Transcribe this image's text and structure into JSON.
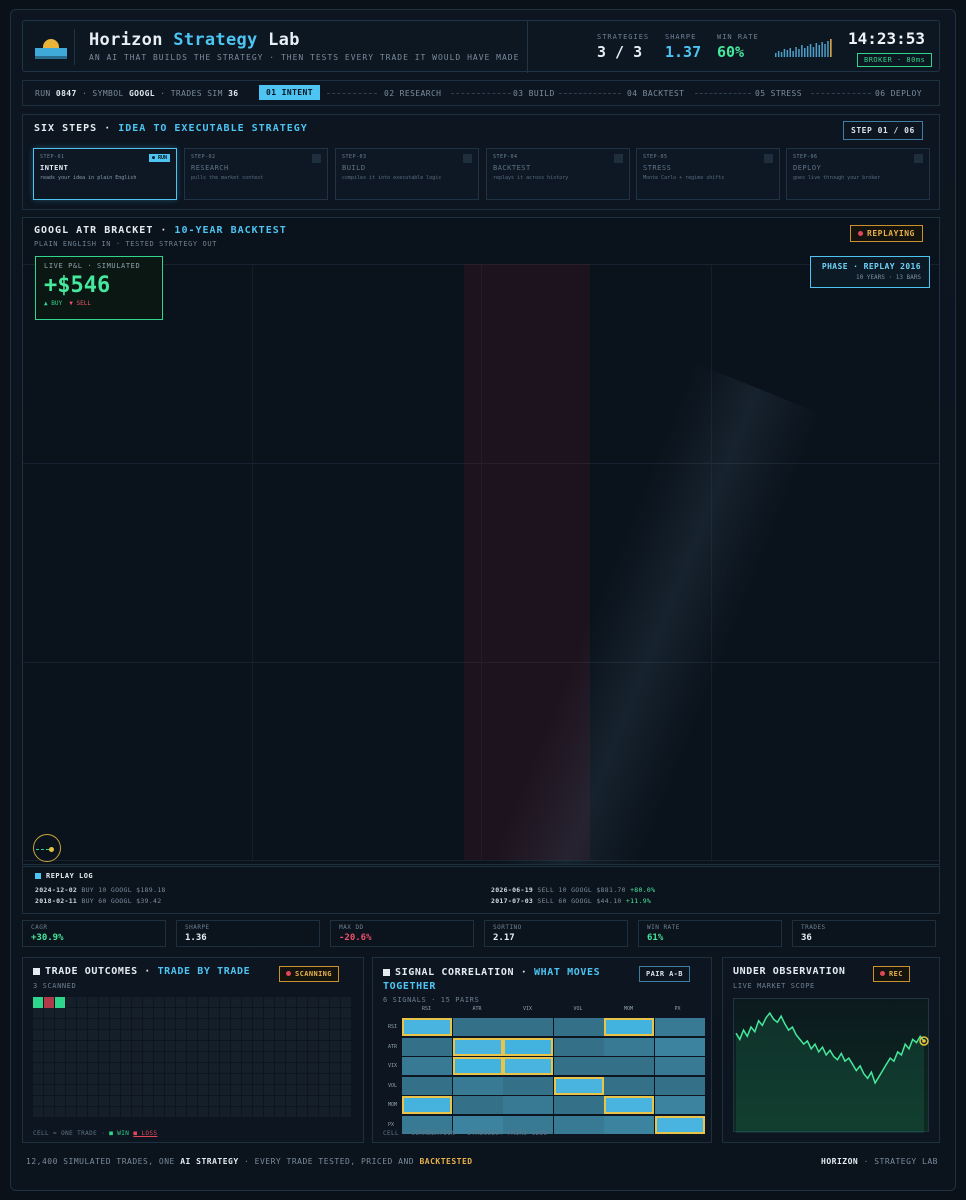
{
  "header": {
    "title_a": "Horizon",
    "title_b": "Strategy",
    "title_c": "Lab",
    "subtitle": "AN AI THAT BUILDS THE STRATEGY · THEN TESTS EVERY TRADE IT WOULD HAVE MADE",
    "stats": [
      {
        "label": "STRATEGIES",
        "value": "3 / 3",
        "color": "#e6edf3"
      },
      {
        "label": "SHARPE",
        "value": "1.37",
        "color": "#4dc4f2"
      },
      {
        "label": "WIN RATE",
        "value": "60%",
        "color": "#45e89c"
      }
    ],
    "clock": "14:23:53",
    "broker": "BROKER · 80ms"
  },
  "pipeline": {
    "run_label": "RUN",
    "run_value": "0847",
    "symbol_label": "SYMBOL",
    "symbol_value": "GOOGL",
    "trades_label": "TRADES SIM",
    "trades_value": "36",
    "steps": [
      "01 INTENT",
      "02 RESEARCH",
      "03 BUILD",
      "04 BACKTEST",
      "05 STRESS",
      "06 DEPLOY"
    ]
  },
  "six_steps": {
    "title": "SIX STEPS",
    "title_accent": "IDEA TO EXECUTABLE STRATEGY",
    "step_badge": "STEP 01 / 06",
    "cards": [
      {
        "num": "STEP-01",
        "name": "INTENT",
        "desc": "reads your idea in plain English",
        "tag": "● RUN"
      },
      {
        "num": "STEP-02",
        "name": "RESEARCH",
        "desc": "pulls the market context"
      },
      {
        "num": "STEP-03",
        "name": "BUILD",
        "desc": "compiles it into executable logic"
      },
      {
        "num": "STEP-04",
        "name": "BACKTEST",
        "desc": "replays it across history"
      },
      {
        "num": "STEP-05",
        "name": "STRESS",
        "desc": "Monte Carlo + regime shifts"
      },
      {
        "num": "STEP-06",
        "name": "DEPLOY",
        "desc": "goes live through your broker"
      }
    ]
  },
  "main": {
    "title": "GOOGL ATR BRACKET",
    "title_accent": "10-YEAR BACKTEST",
    "subtitle": "PLAIN ENGLISH IN · TESTED STRATEGY OUT",
    "status": "REPLAYING",
    "pnl_label": "LIVE P&L · SIMULATED",
    "pnl_value": "+$546",
    "legend_buy": "▲ BUY",
    "legend_sell": "▼ SELL",
    "phase_title": "PHASE · REPLAY 2016",
    "phase_sub": "10 YEARS · 13 BARS"
  },
  "replay_log": {
    "title": "REPLAY LOG",
    "entries": [
      {
        "date": "2024-12-02",
        "text": "BUY 10 GOOGL $189.18",
        "change": ""
      },
      {
        "date": "2018-02-11",
        "text": "BUY 60 GOOGL $39.42",
        "change": ""
      },
      {
        "date": "2026-06-19",
        "text": "SELL 10 GOOGL $881.70",
        "change": "+80.0%"
      },
      {
        "date": "2017-07-03",
        "text": "SELL 60 GOOGL $44.10",
        "change": "+11.9%"
      }
    ]
  },
  "metrics": [
    {
      "label": "CAGR",
      "value": "+30.9%",
      "color": "#45e89c"
    },
    {
      "label": "SHARPE",
      "value": "1.36",
      "color": "#e6edf3"
    },
    {
      "label": "MAX DD",
      "value": "-20.6%",
      "color": "#f0506a"
    },
    {
      "label": "SORTINO",
      "value": "2.17",
      "color": "#e6edf3"
    },
    {
      "label": "WIN RATE",
      "value": "61%",
      "color": "#45e89c"
    },
    {
      "label": "TRADES",
      "value": "36",
      "color": "#e6edf3"
    }
  ],
  "outcomes": {
    "title": "TRADE OUTCOMES",
    "title_accent": "TRADE BY TRADE",
    "status": "SCANNING",
    "sub": "3 SCANNED",
    "foot_a": "CELL = ONE TRADE ·",
    "foot_win": "■ WIN",
    "foot_loss": "■ LOSS",
    "scanned": [
      "win",
      "loss",
      "win"
    ]
  },
  "correlation": {
    "title": "SIGNAL CORRELATION",
    "title_accent": "WHAT MOVES TOGETHER",
    "sub": "6 SIGNALS · 15 PAIRS",
    "badge": "PAIR A-B",
    "labels": [
      "RSI",
      "ATR",
      "VIX",
      "VOL",
      "MOM",
      "PX"
    ],
    "matrix": [
      [
        1.0,
        0.3,
        0.3,
        0.3,
        0.8,
        0.4
      ],
      [
        0.3,
        1.0,
        0.8,
        0.3,
        0.4,
        0.5
      ],
      [
        0.4,
        0.8,
        1.0,
        0.3,
        0.3,
        0.4
      ],
      [
        0.3,
        0.4,
        0.3,
        1.0,
        0.3,
        0.3
      ],
      [
        0.9,
        0.3,
        0.4,
        0.3,
        1.0,
        0.5
      ],
      [
        0.4,
        0.5,
        0.4,
        0.4,
        0.5,
        1.0
      ]
    ],
    "foot": "CELL = CORRELATION · STRONGEST PAIRS GLOW"
  },
  "observation": {
    "title": "UNDER OBSERVATION",
    "sub": "LIVE MARKET SCOPE",
    "status": "REC",
    "series": [
      62,
      58,
      64,
      60,
      66,
      63,
      70,
      67,
      72,
      75,
      71,
      69,
      73,
      68,
      64,
      66,
      61,
      58,
      55,
      57,
      52,
      55,
      50,
      53,
      48,
      51,
      47,
      45,
      49,
      44,
      46,
      42,
      38,
      41,
      36,
      33,
      37,
      30,
      34,
      38,
      42,
      46,
      44,
      50,
      48,
      55,
      52,
      58,
      56,
      60,
      57
    ]
  },
  "footer": {
    "pre": "12,400 SIMULATED TRADES, ONE",
    "bold": "AI STRATEGY",
    "mid": "· EVERY TRADE TESTED, PRICED AND",
    "hl": "BACKTESTED",
    "right_bold": "HORIZON",
    "right": "· STRATEGY LAB"
  },
  "colors": {
    "accent": "#4dc4f2",
    "win": "#2fd58a",
    "loss": "#b03a4a",
    "amber": "#e8b14a"
  }
}
